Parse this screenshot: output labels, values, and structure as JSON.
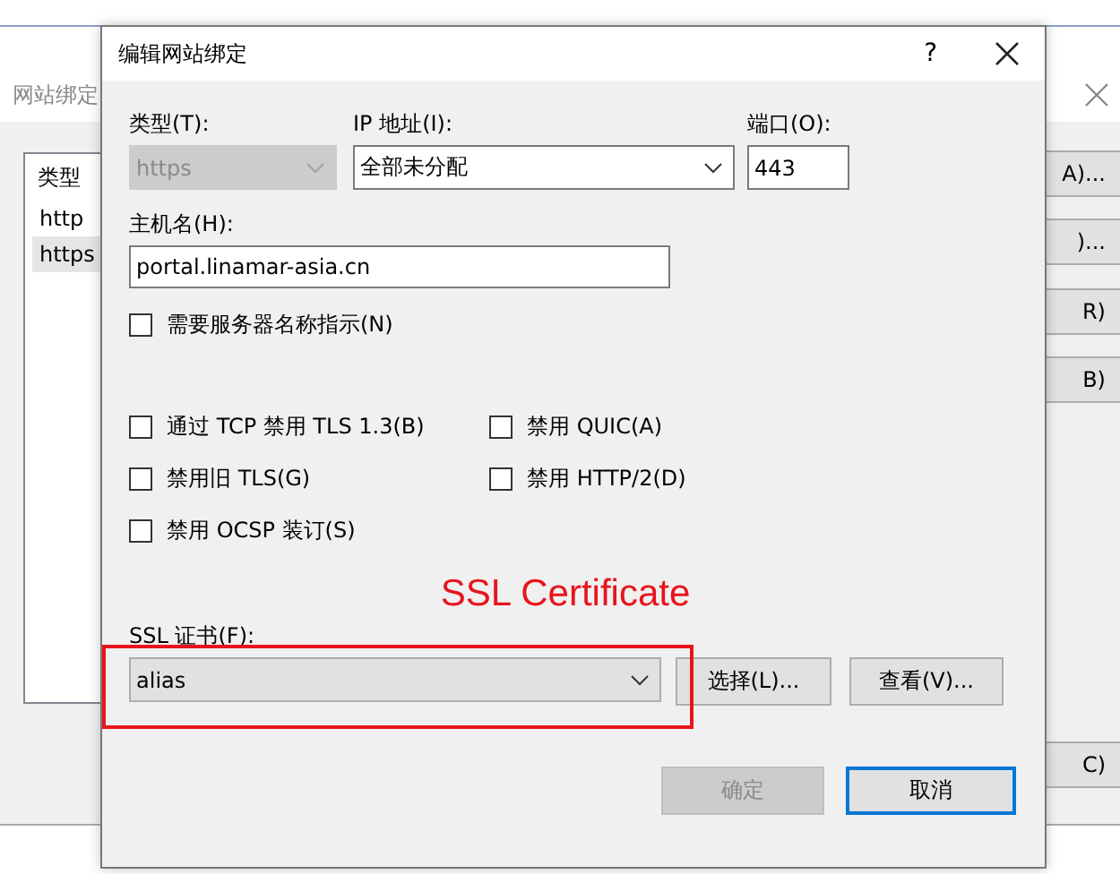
{
  "background_window": {
    "title": "网站绑定",
    "list": {
      "columns": [
        "类型"
      ],
      "rows": [
        {
          "type": "http",
          "selected": false
        },
        {
          "type": "https",
          "selected": true
        }
      ]
    },
    "buttons": [
      "A)...",
      ")...",
      "R)",
      "B)",
      "C)"
    ]
  },
  "dialog": {
    "title": "编辑网站绑定",
    "help": "?",
    "type": {
      "label": "类型(T):",
      "value": "https",
      "disabled": true
    },
    "ip": {
      "label": "IP 地址(I):",
      "value": "全部未分配"
    },
    "port": {
      "label": "端口(O):",
      "value": "443"
    },
    "host": {
      "label": "主机名(H):",
      "value": "portal.linamar-asia.cn"
    },
    "sni": {
      "label": "需要服务器名称指示(N)",
      "checked": false
    },
    "options": [
      {
        "label": "通过 TCP 禁用 TLS 1.3(B)",
        "checked": false
      },
      {
        "label": "禁用 QUIC(A)",
        "checked": false
      },
      {
        "label": "禁用旧 TLS(G)",
        "checked": false
      },
      {
        "label": "禁用 HTTP/2(D)",
        "checked": false
      },
      {
        "label": "禁用 OCSP 装订(S)",
        "checked": false
      }
    ],
    "annotation": "SSL Certificate",
    "ssl": {
      "label": "SSL 证书(F):",
      "value": "alias",
      "highlighted": true
    },
    "cert_buttons": [
      "选择(L)...",
      "查看(V)..."
    ],
    "buttons": [
      {
        "label": "确定",
        "disabled": true,
        "default": false
      },
      {
        "label": "取消",
        "disabled": false,
        "default": true
      }
    ]
  }
}
